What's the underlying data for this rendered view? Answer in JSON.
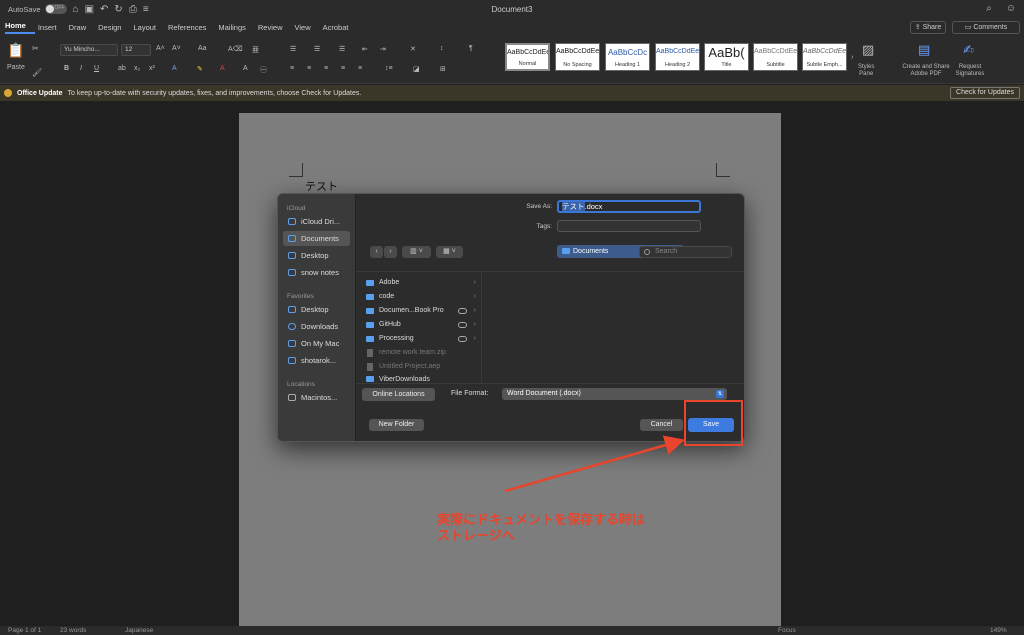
{
  "titlebar": {
    "autosave_label": "AutoSave",
    "autosave_state": "OFF",
    "document_title": "Document3"
  },
  "tabs": [
    "Home",
    "Insert",
    "Draw",
    "Design",
    "Layout",
    "References",
    "Mailings",
    "Review",
    "View",
    "Acrobat"
  ],
  "share_label": "Share",
  "comments_label": "Comments",
  "ribbon": {
    "paste_label": "Paste",
    "font_name": "Yu Mincho...",
    "font_size": "12",
    "styles": [
      {
        "sample": "AaBbCcDdEe",
        "name": "Normal"
      },
      {
        "sample": "AaBbCcDdEe",
        "name": "No Spacing"
      },
      {
        "sample": "AaBbCcDc",
        "name": "Heading 1"
      },
      {
        "sample": "AaBbCcDdEe",
        "name": "Heading 2"
      },
      {
        "sample": "AaBb(",
        "name": "Title"
      },
      {
        "sample": "AaBbCcDdEe",
        "name": "Subtitle"
      },
      {
        "sample": "AaBbCcDdEe",
        "name": "Subtle Emph..."
      }
    ],
    "styles_pane_label": "Styles\nPane",
    "create_share_label": "Create and Share\nAdobe PDF",
    "request_signatures_label": "Request\nSignatures"
  },
  "update_bar": {
    "title": "Office Update",
    "message": "To keep up-to-date with security updates, fixes, and improvements, choose Check for Updates.",
    "button_label": "Check for Updates"
  },
  "document": {
    "body_text": "テスト"
  },
  "save_dialog": {
    "sidebar": {
      "icloud_header": "iCloud",
      "icloud_items": [
        "iCloud Dri...",
        "Documents",
        "Desktop",
        "snow notes"
      ],
      "favorites_header": "Favorites",
      "favorites_items": [
        "Desktop",
        "Downloads",
        "On My Mac",
        "shotarok..."
      ],
      "locations_header": "Locations",
      "locations_items": [
        "Macintos..."
      ]
    },
    "save_as_label": "Save As:",
    "save_as_value_highlighted": "テスト",
    "save_as_value_rest": ".docx",
    "tags_label": "Tags:",
    "location": "Documents",
    "search_placeholder": "Search",
    "files": [
      {
        "name": "Adobe",
        "kind": "folder"
      },
      {
        "name": "code",
        "kind": "folder"
      },
      {
        "name": "Documen...Book Pro",
        "kind": "folder-cloud"
      },
      {
        "name": "GitHub",
        "kind": "folder-cloud"
      },
      {
        "name": "Processing",
        "kind": "folder-cloud"
      },
      {
        "name": "remote work team.zip",
        "kind": "file"
      },
      {
        "name": "Untitled Project.aep",
        "kind": "file"
      },
      {
        "name": "ViberDownloads",
        "kind": "folder"
      }
    ],
    "online_locations_label": "Online Locations",
    "file_format_label": "File Format:",
    "file_format_value": "Word Document (.docx)",
    "new_folder_label": "New Folder",
    "cancel_label": "Cancel",
    "save_label": "Save"
  },
  "annotation": {
    "line1": "実際にドキュメントを保存する時は",
    "line2": "ストレージへ",
    "color": "#e8452c"
  },
  "status": {
    "page": "Page 1 of 1",
    "words": "23 words",
    "language": "Japanese",
    "focus": "Focus",
    "zoom": "149%"
  }
}
